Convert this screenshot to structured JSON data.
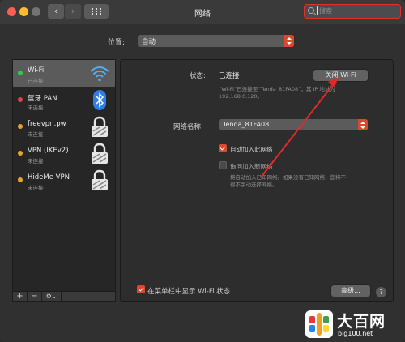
{
  "window": {
    "title": "网络"
  },
  "search": {
    "placeholder": "搜索"
  },
  "location": {
    "label": "位置:",
    "value": "自动"
  },
  "services": [
    {
      "name": "Wi-Fi",
      "status": "已连接",
      "dot": "#34c84a",
      "icon": "wifi-icon"
    },
    {
      "name": "蓝牙 PAN",
      "status": "未连接",
      "dot": "#e0443e",
      "icon": "bluetooth-icon"
    },
    {
      "name": "freevpn.pw",
      "status": "未连接",
      "dot": "#e8a42c",
      "icon": "lock-icon"
    },
    {
      "name": "VPN (IKEv2)",
      "status": "未连接",
      "dot": "#e8a42c",
      "icon": "lock-icon"
    },
    {
      "name": "HideMe VPN",
      "status": "未连接",
      "dot": "#e8a42c",
      "icon": "lock-icon"
    }
  ],
  "toolbar": {
    "add": "+",
    "remove": "−",
    "action": "⚙⌄"
  },
  "detail": {
    "status_label": "状态:",
    "status_value": "已连接",
    "turn_off_button": "关闭 Wi-Fi",
    "status_desc_1": "“Wi-Fi”已连接至“Tenda_81FA08”，其 IP 地址为",
    "status_desc_2": "192.168.0.120。",
    "network_name_label": "网络名称:",
    "network_name_value": "Tenda_81FA08",
    "auto_join_label": "自动加入此网络",
    "ask_join_label": "询问加入新网络",
    "ask_desc_1": "将自动加入已知网络。如果没有已知网络，您将不",
    "ask_desc_2": "得不手动选择网络。",
    "menubar_label": "在菜单栏中显示 Wi-Fi 状态",
    "advanced_button": "高级...",
    "help_button": "?"
  },
  "watermark": {
    "name": "大百网",
    "url": "big100.net"
  },
  "colors": {
    "accent": "#d9492f",
    "annotation_arrow": "#e02a2a"
  }
}
